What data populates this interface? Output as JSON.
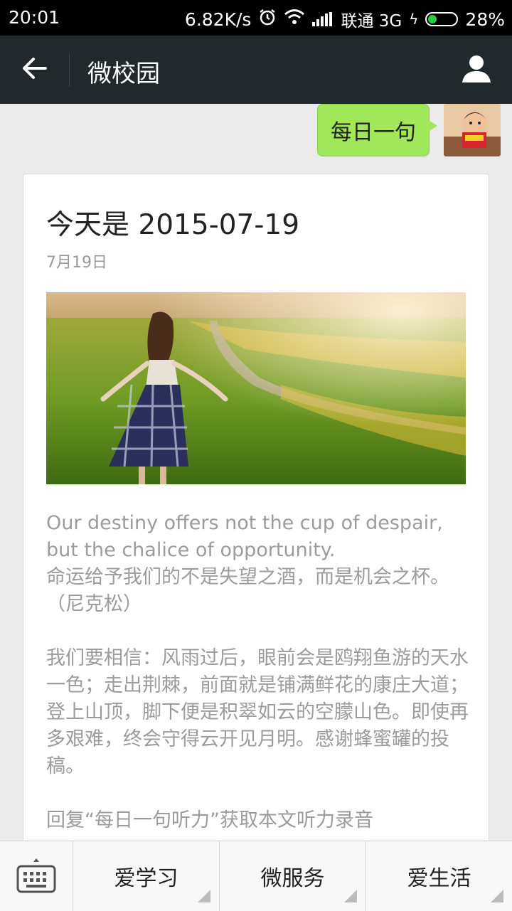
{
  "status_bar": {
    "time": "20:01",
    "speed": "6.82K/s",
    "carrier": "联通 3G",
    "battery": "28%",
    "battery_level": 0.28
  },
  "app_bar": {
    "title": "微校园",
    "back_icon": "arrow-left-icon",
    "profile_icon": "user-icon"
  },
  "message": {
    "text": "每日一句"
  },
  "article": {
    "headline": "今天是 2015-07-19",
    "date": "7月19日",
    "paragraphs": [
      "Our destiny offers not the cup of despair, but the chalice of opportunity.",
      "命运给予我们的不是失望之酒，而是机会之杯。（尼克松）",
      "我们要相信：风雨过后，眼前会是鸥翔鱼游的天水一色；走出荆棘，前面就是铺满鲜花的康庄大道；登上山顶，脚下便是积翠如云的空朦山色。即使再多艰难，终会守得云开见月明。感谢蜂蜜罐的投稿。",
      "回复“每日一句听力”获取本文听力录音"
    ]
  },
  "bottom_menu": {
    "keyboard_icon": "keyboard-icon",
    "items": [
      "爱学习",
      "微服务",
      "爱生活"
    ]
  },
  "colors": {
    "app_bar": "#21292c",
    "bubble": "#a0e75a",
    "background": "#ebebeb"
  }
}
